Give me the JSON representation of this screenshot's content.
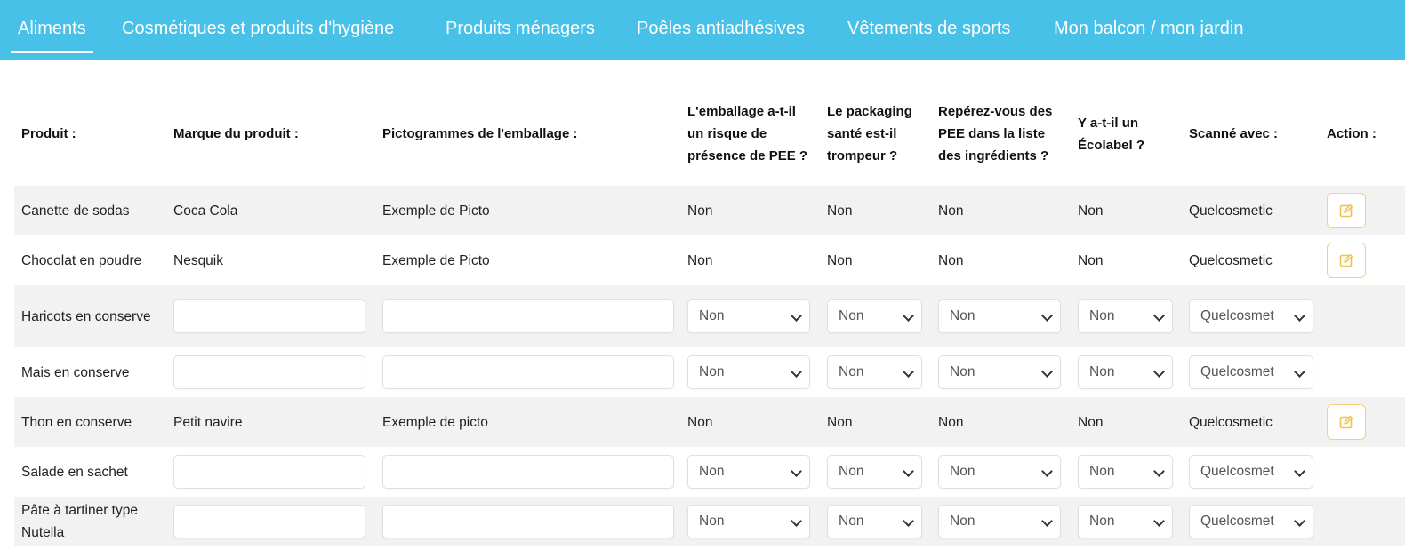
{
  "tabs": [
    {
      "label": "Aliments",
      "active": true
    },
    {
      "label": "Cosmétiques et produits d'hygiène",
      "active": false
    },
    {
      "label": "Produits ménagers",
      "active": false
    },
    {
      "label": "Poêles antiadhésives",
      "active": false
    },
    {
      "label": "Vêtements de sports",
      "active": false
    },
    {
      "label": "Mon balcon / mon jardin",
      "active": false
    }
  ],
  "columns": {
    "produit": "Produit :",
    "marque": "Marque du produit :",
    "picto": "Pictogrammes de l'emballage :",
    "risque": "L'emballage a-t-il un risque de présence de PEE ?",
    "trompeur": "Le packaging santé est-il trompeur ?",
    "pee": "Repérez-vous des PEE dans la liste des ingrédients ?",
    "ecolabel": "Y a-t-il un Écolabel ?",
    "scanne": "Scanné avec :",
    "action": "Action :"
  },
  "rows": [
    {
      "produit": "Canette de sodas",
      "marque": "Coca Cola",
      "picto": "Exemple de Picto",
      "risque": "Non",
      "trompeur": "Non",
      "pee": "Non",
      "ecolabel": "Non",
      "scanne": "Quelcosmetic"
    },
    {
      "produit": "Chocolat en poudre",
      "marque": "Nesquik",
      "picto": "Exemple de Picto",
      "risque": "Non",
      "trompeur": "Non",
      "pee": "Non",
      "ecolabel": "Non",
      "scanne": "Quelcosmetic"
    },
    {
      "produit": "Haricots en conserve",
      "marque": "",
      "picto": "",
      "risque": "Non",
      "trompeur": "Non",
      "pee": "Non",
      "ecolabel": "Non",
      "scanne": "Quelcosmet"
    },
    {
      "produit": "Mais en conserve",
      "marque": "",
      "picto": "",
      "risque": "Non",
      "trompeur": "Non",
      "pee": "Non",
      "ecolabel": "Non",
      "scanne": "Quelcosmet"
    },
    {
      "produit": "Thon en conserve",
      "marque": "Petit navire",
      "picto": "Exemple de picto",
      "risque": "Non",
      "trompeur": "Non",
      "pee": "Non",
      "ecolabel": "Non",
      "scanne": "Quelcosmetic"
    },
    {
      "produit": "Salade en sachet",
      "marque": "",
      "picto": "",
      "risque": "Non",
      "trompeur": "Non",
      "pee": "Non",
      "ecolabel": "Non",
      "scanne": "Quelcosmet"
    },
    {
      "produit": "Pâte à tartiner type Nutella",
      "marque": "",
      "picto": "",
      "risque": "Non",
      "trompeur": "Non",
      "pee": "Non",
      "ecolabel": "Non",
      "scanne": "Quelcosmet"
    }
  ],
  "icons": {
    "edit": "edit-pencil-icon"
  },
  "colors": {
    "header_bg": "#47c1e8",
    "edit_border": "#f4d27a",
    "edit_icon": "#f0c24e",
    "odd_row": "#f2f2f2"
  }
}
